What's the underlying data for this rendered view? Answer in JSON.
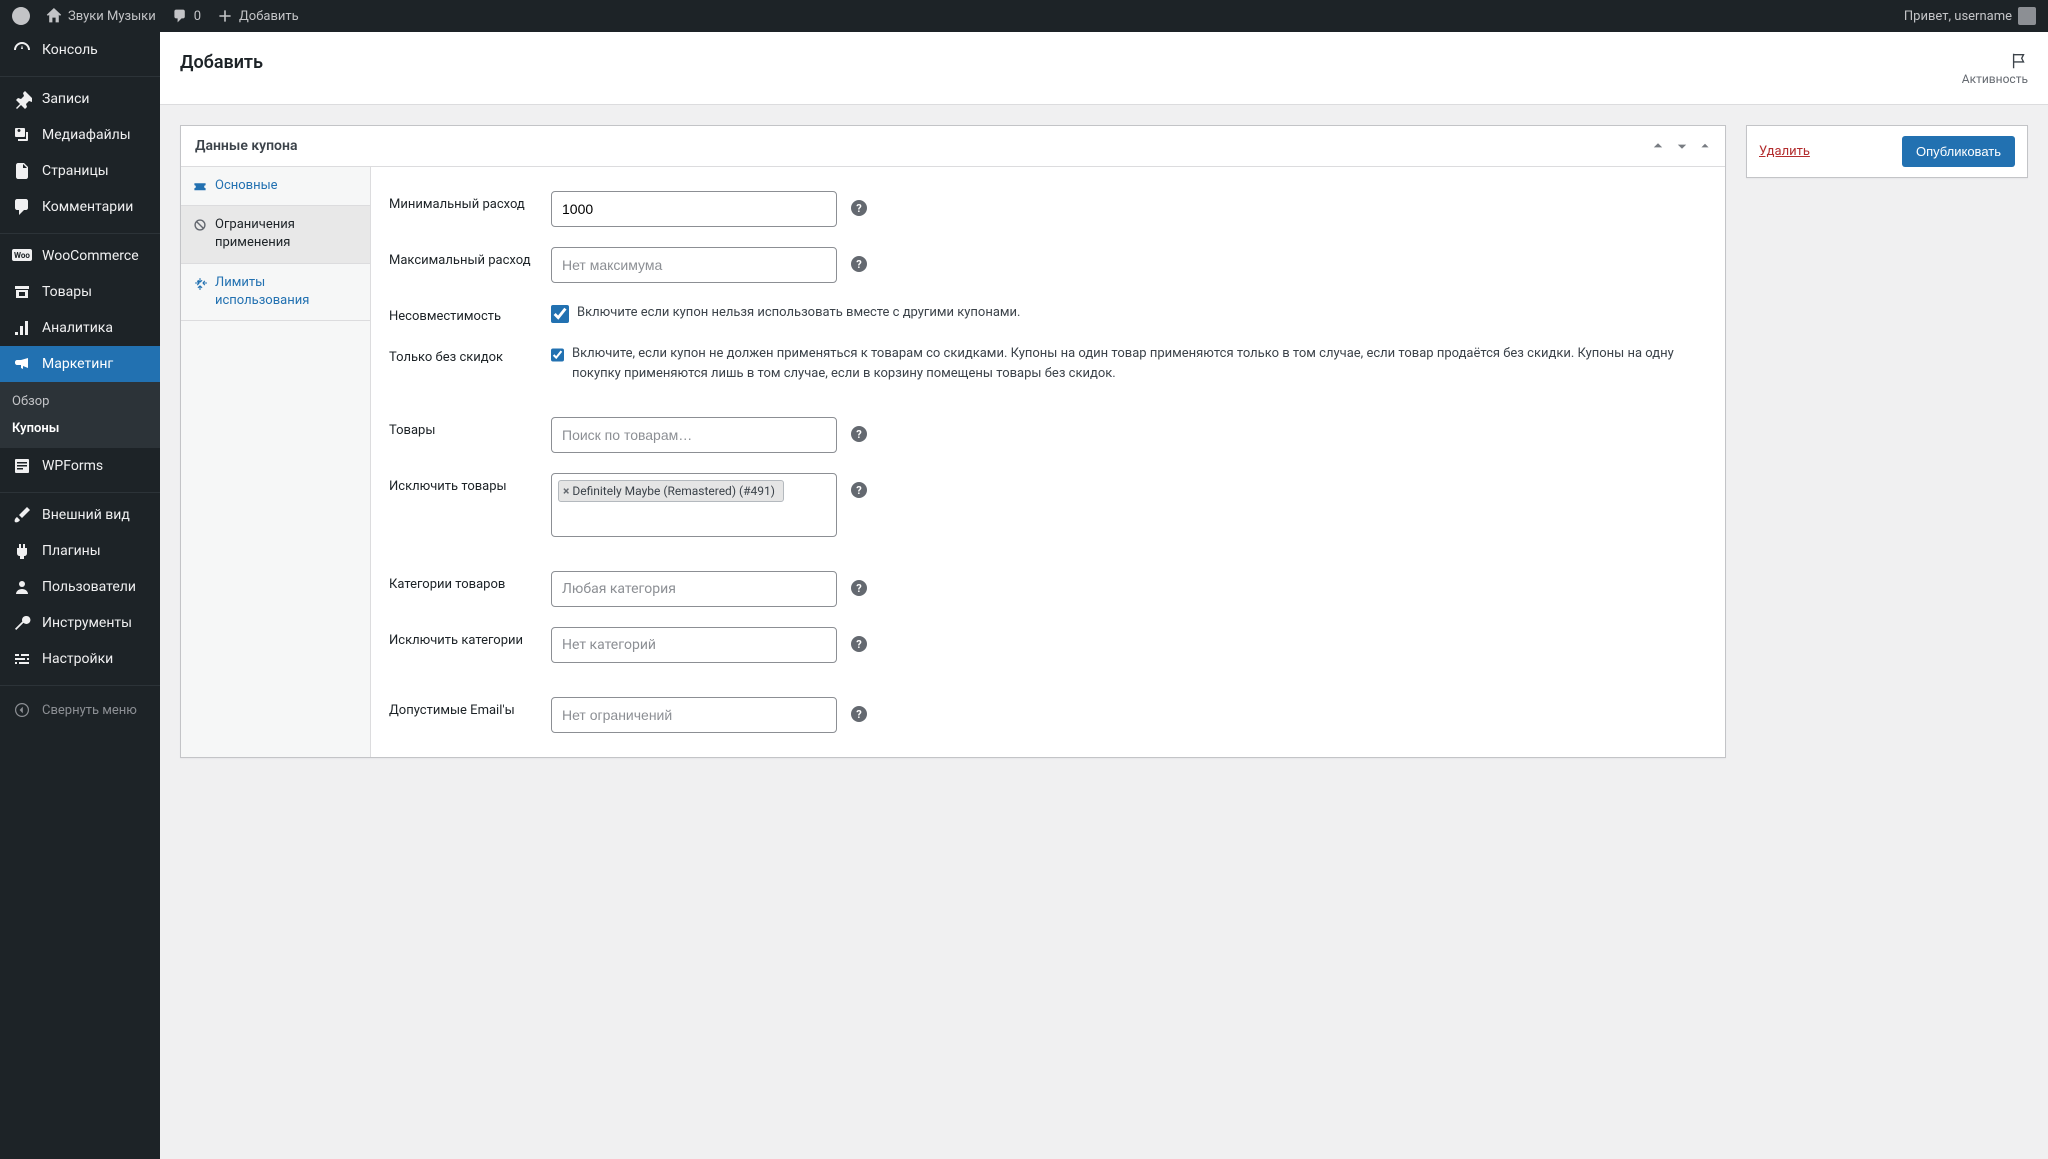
{
  "adminbar": {
    "site_name": "Звуки Музыки",
    "comments_count": "0",
    "add_new": "Добавить",
    "greeting": "Привет, username"
  },
  "sidebar": {
    "items": [
      {
        "label": "Консоль"
      },
      {
        "label": "Записи"
      },
      {
        "label": "Медиафайлы"
      },
      {
        "label": "Страницы"
      },
      {
        "label": "Комментарии"
      },
      {
        "label": "WooCommerce"
      },
      {
        "label": "Товары"
      },
      {
        "label": "Аналитика"
      },
      {
        "label": "Маркетинг"
      },
      {
        "label": "WPForms"
      },
      {
        "label": "Внешний вид"
      },
      {
        "label": "Плагины"
      },
      {
        "label": "Пользователи"
      },
      {
        "label": "Инструменты"
      },
      {
        "label": "Настройки"
      }
    ],
    "submenu": [
      {
        "label": "Обзор"
      },
      {
        "label": "Купоны"
      }
    ],
    "collapse": "Свернуть меню"
  },
  "header": {
    "title": "Добавить",
    "activity": "Активность"
  },
  "metabox": {
    "title": "Данные купона",
    "tabs": [
      {
        "label": "Основные"
      },
      {
        "label": "Ограничения применения"
      },
      {
        "label": "Лимиты использования"
      }
    ],
    "fields": {
      "min_spend_label": "Минимальный расход",
      "min_spend_value": "1000",
      "max_spend_label": "Максимальный расход",
      "max_spend_placeholder": "Нет максимума",
      "individual_label": "Несовместимость",
      "individual_desc": "Включите если купон нельзя использовать вместе с другими купонами.",
      "exclude_sale_label": "Только без скидок",
      "exclude_sale_desc": "Включите, если купон не должен применяться к товарам со скидками. Купоны на один товар применяются только в том случае, если товар продаётся без скидки. Купоны на одну покупку применяются лишь в том случае, если в корзину помещены товары без скидок.",
      "products_label": "Товары",
      "products_placeholder": "Поиск по товарам…",
      "exclude_products_label": "Исключить товары",
      "exclude_products_tag": "Definitely Maybe (Remastered) (#491)",
      "categories_label": "Категории товаров",
      "categories_placeholder": "Любая категория",
      "exclude_categories_label": "Исключить категории",
      "exclude_categories_placeholder": "Нет категорий",
      "emails_label": "Допустимые Email'ы",
      "emails_placeholder": "Нет ограничений"
    }
  },
  "publish": {
    "delete": "Удалить",
    "publish": "Опубликовать"
  }
}
